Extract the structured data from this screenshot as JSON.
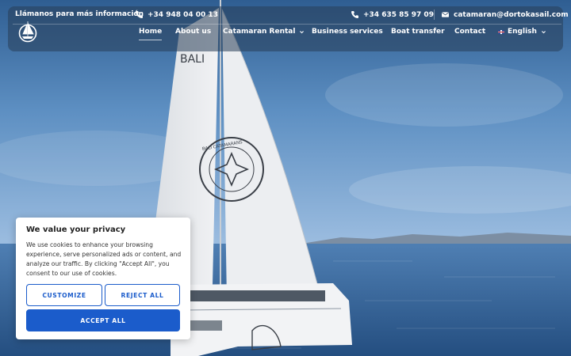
{
  "topbar": {
    "info_label": "Llámanos para más información",
    "phone_primary": "+34 948 04 00 13",
    "phone_secondary": "+34 635 85 97 09",
    "email": "catamaran@dortokasail.com"
  },
  "nav": {
    "items": [
      {
        "label": "Home",
        "active": true
      },
      {
        "label": "About us"
      },
      {
        "label": "Catamaran Rental",
        "dropdown": true
      },
      {
        "label": "Business services"
      },
      {
        "label": "Boat transfer"
      },
      {
        "label": "Contact"
      }
    ],
    "language": {
      "label": "English",
      "flag": "uk-flag-icon"
    }
  },
  "hero": {
    "sail_text_top": "BALI",
    "sail_badge_text": "BALI CATAMARANS",
    "colors": {
      "sky": "#5c8dbf",
      "sea": "#2f5f93",
      "sail": "#e9ebee"
    }
  },
  "cookie": {
    "title": "We value your privacy",
    "body": "We use cookies to enhance your browsing experience, serve personalized ads or content, and analyze our traffic. By clicking \"Accept All\", you consent to our use of cookies.",
    "customize_label": "CUSTOMIZE",
    "reject_label": "REJECT ALL",
    "accept_label": "ACCEPT ALL",
    "accent": "#1b5ccb"
  }
}
